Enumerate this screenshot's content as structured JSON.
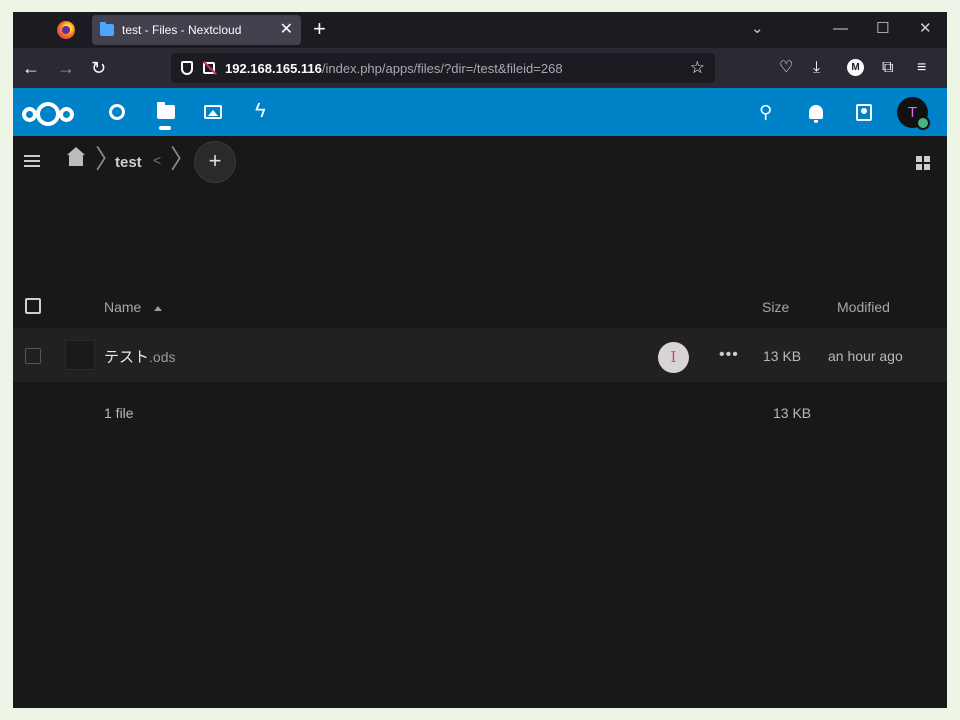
{
  "browser": {
    "tab_title": "test - Files - Nextcloud",
    "tab_close": "✕",
    "new_tab": "+",
    "url_host": "192.168.165.116",
    "url_path": "/index.php/apps/files/?dir=/test&fileid=268",
    "profile_badge": "M"
  },
  "nextcloud": {
    "user_initial": "T"
  },
  "breadcrumb": {
    "folder": "test",
    "add_label": "+"
  },
  "table": {
    "columns": {
      "name": "Name",
      "size": "Size",
      "modified": "Modified"
    },
    "rows": [
      {
        "name": "テスト",
        "ext": ".ods",
        "size": "13 KB",
        "modified": "an hour ago"
      }
    ],
    "summary": {
      "count": "1 file",
      "size": "13 KB"
    }
  },
  "colors": {
    "nextcloud_blue": "#0082c9",
    "background": "#181818",
    "row_highlight": "#212121",
    "status_online": "#49b382"
  },
  "icons": [
    "firefox-icon",
    "folder-icon",
    "back-icon",
    "forward-icon",
    "reload-icon",
    "shield-icon",
    "lock-icon",
    "star-icon",
    "pocket-icon",
    "download-icon",
    "extensions-icon",
    "menu-icon",
    "nextcloud-logo-icon",
    "dashboard-icon",
    "files-icon",
    "photos-icon",
    "activity-icon",
    "search-icon",
    "bell-icon",
    "contacts-icon",
    "home-icon",
    "share-icon",
    "grid-icon",
    "more-icon",
    "text-cursor-icon"
  ]
}
